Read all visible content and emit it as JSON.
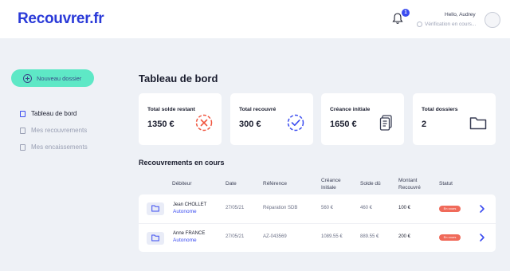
{
  "header": {
    "logo": "Recouvrer.fr",
    "notification_count": "1",
    "greeting": "Hello, Audrey",
    "verification_status": "Vérification en cours..."
  },
  "sidebar": {
    "new_button_label": "Nouveau dossier",
    "items": [
      {
        "label": "Tableau de bord",
        "active": true
      },
      {
        "label": "Mes recouvrements",
        "active": false
      },
      {
        "label": "Mes encaissements",
        "active": false
      }
    ]
  },
  "main": {
    "title": "Tableau de bord",
    "cards": [
      {
        "title": "Total solde restant",
        "value": "1350 €",
        "icon": "x-circle-icon"
      },
      {
        "title": "Total recouvré",
        "value": "300 €",
        "icon": "check-circle-icon"
      },
      {
        "title": "Créance initiale",
        "value": "1650 €",
        "icon": "document-icon"
      },
      {
        "title": "Total dossiers",
        "value": "2",
        "icon": "folder-icon"
      }
    ],
    "section_title": "Recouvrements en cours",
    "table": {
      "headers": {
        "debtor": "Débiteur",
        "date": "Date",
        "reference": "Référence",
        "initial_claim_1": "Créance",
        "initial_claim_2": "Initiale",
        "balance_due": "Solde dû",
        "recovered_1": "Montant",
        "recovered_2": "Recouvré",
        "status": "Statut"
      },
      "rows": [
        {
          "debtor_name": "Jean CHOLLET",
          "debtor_type": "Autonome",
          "date": "27/05/21",
          "reference": "Réparation SDB",
          "initial_claim": "560 €",
          "balance_due": "460 €",
          "recovered": "100 €",
          "status": "En cours"
        },
        {
          "debtor_name": "Anne FRANCE",
          "debtor_type": "Autonome",
          "date": "27/05/21",
          "reference": "AZ-043569",
          "initial_claim": "1089.55 €",
          "balance_due": "889.55 €",
          "recovered": "200 €",
          "status": "En cours"
        }
      ]
    }
  },
  "colors": {
    "brand": "#2a3ad8",
    "accent_button": "#5ee8c6",
    "status_in_progress": "#f06a5a",
    "icon_red": "#f0553f",
    "icon_blue": "#3b4cf0"
  }
}
